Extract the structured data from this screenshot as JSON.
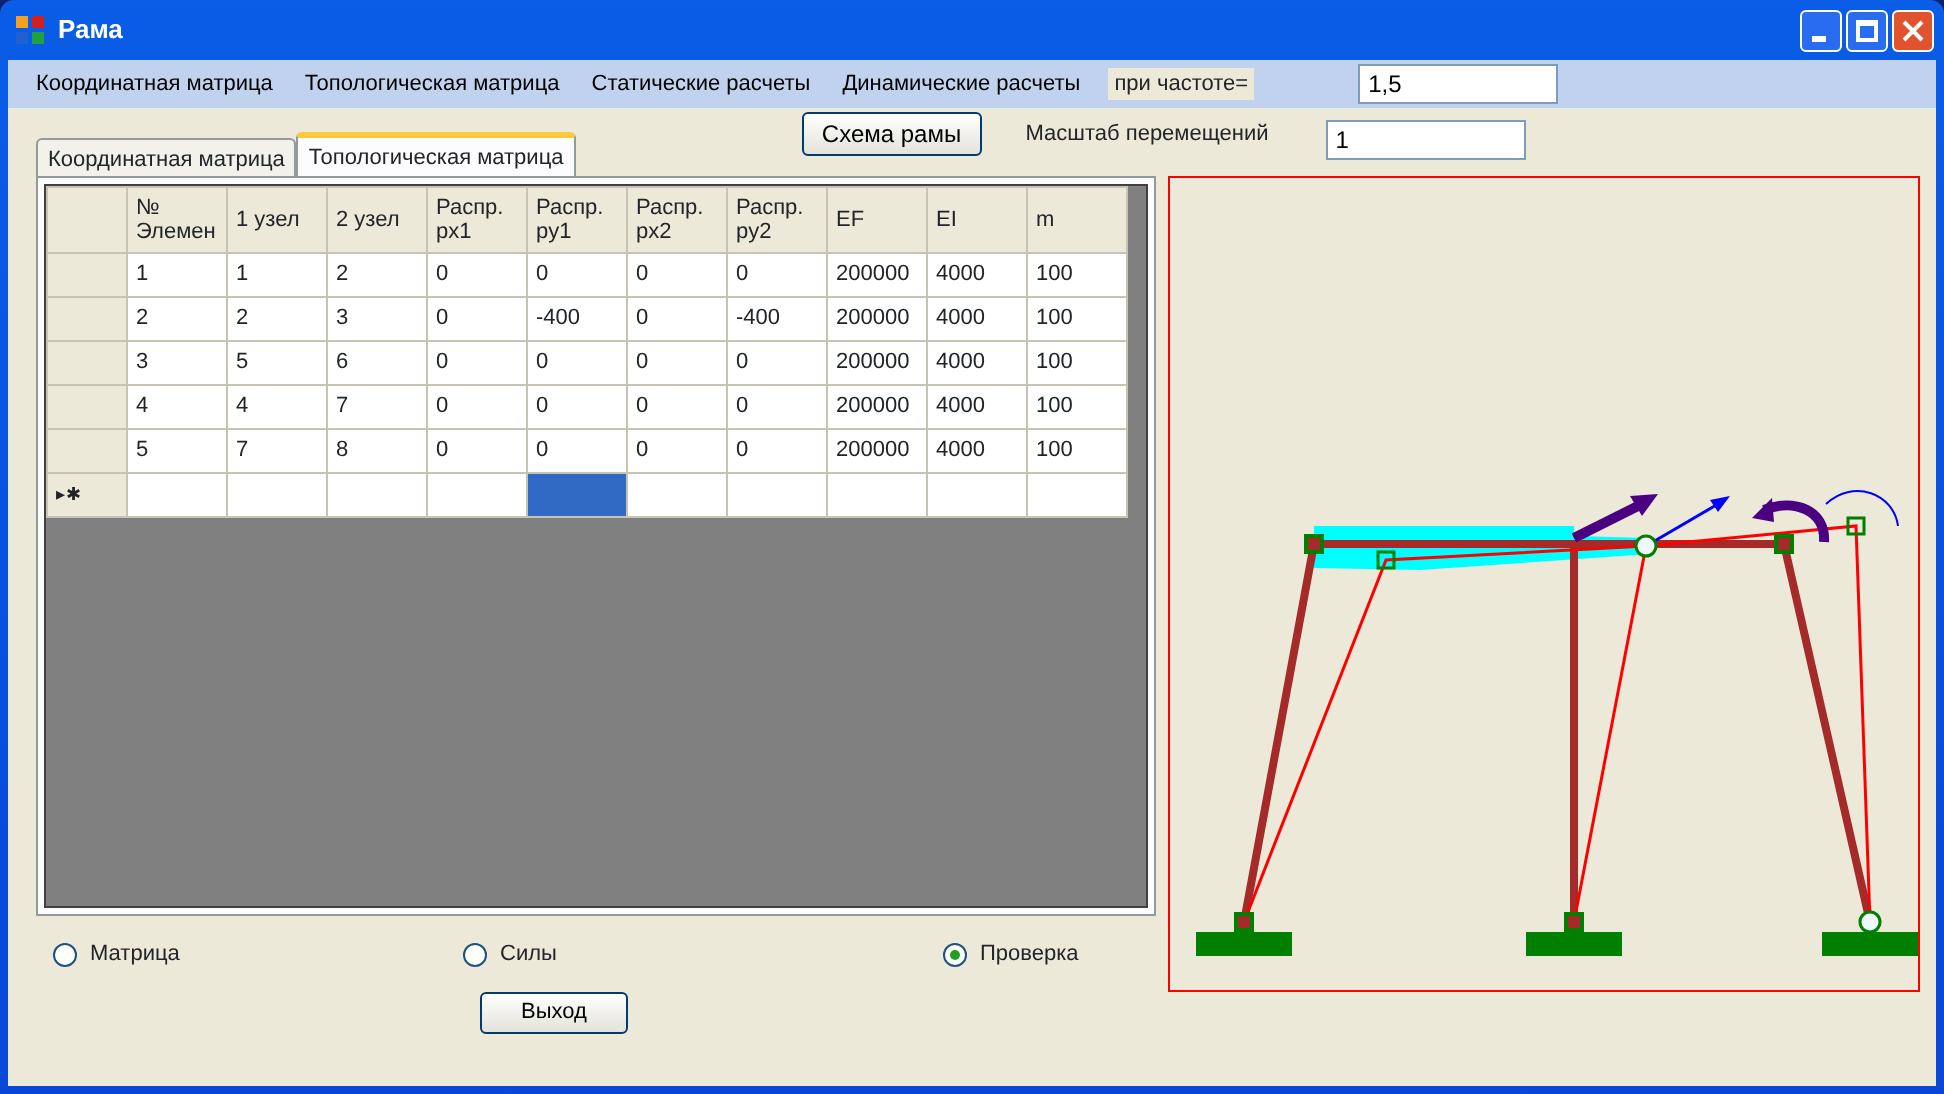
{
  "window": {
    "title": "Рама"
  },
  "menu": [
    {
      "label": "Координатная матрица"
    },
    {
      "label": "Топологическая матрица"
    },
    {
      "label": "Статические расчеты"
    },
    {
      "label": "Динамические расчеты"
    }
  ],
  "frequency": {
    "label": "при частоте=",
    "value": "1,5"
  },
  "tabs": [
    {
      "label": "Координатная матрица",
      "selected": false
    },
    {
      "label": "Топологическая матрица",
      "selected": true
    }
  ],
  "scheme_button": "Схема рамы",
  "scale": {
    "label": "Масштаб перемещений",
    "value": "1"
  },
  "table": {
    "columns": [
      "№ Элемен",
      "1 узел",
      "2 узел",
      "Распр. px1",
      "Распр. py1",
      "Распр. px2",
      "Распр. py2",
      "EF",
      "EI",
      "m"
    ],
    "rows": [
      [
        "1",
        "1",
        "2",
        "0",
        "0",
        "0",
        "0",
        "200000",
        "4000",
        "100"
      ],
      [
        "2",
        "2",
        "3",
        "0",
        "-400",
        "0",
        "-400",
        "200000",
        "4000",
        "100"
      ],
      [
        "3",
        "5",
        "6",
        "0",
        "0",
        "0",
        "0",
        "200000",
        "4000",
        "100"
      ],
      [
        "4",
        "4",
        "7",
        "0",
        "0",
        "0",
        "0",
        "200000",
        "4000",
        "100"
      ],
      [
        "5",
        "7",
        "8",
        "0",
        "0",
        "0",
        "0",
        "200000",
        "4000",
        "100"
      ]
    ],
    "new_row": {
      "marker": "▸✱",
      "cells": [
        {
          "selected": false
        },
        {
          "selected": false
        },
        {
          "selected": false
        },
        {
          "selected": false
        },
        {
          "selected": true
        },
        {
          "selected": false
        },
        {
          "selected": false
        },
        {
          "selected": false
        },
        {
          "selected": false
        },
        {
          "selected": false
        }
      ]
    }
  },
  "radios": [
    {
      "label": "Матрица",
      "selected": false
    },
    {
      "label": "Силы",
      "selected": false
    },
    {
      "label": "Проверка",
      "selected": true
    }
  ],
  "exit_button": "Выход"
}
